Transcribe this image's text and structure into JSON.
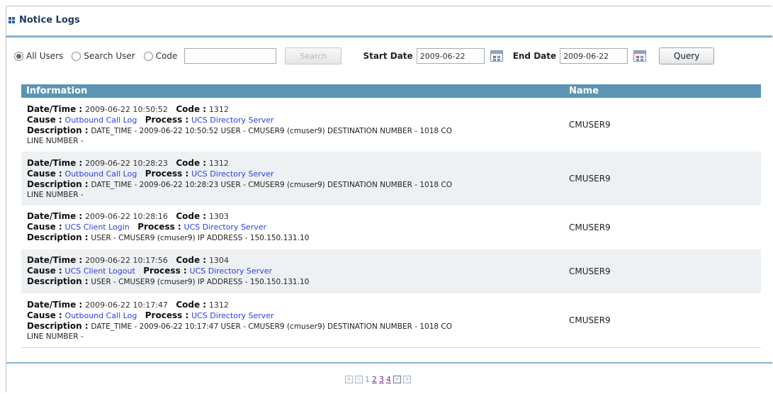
{
  "header": {
    "title": "Notice Logs"
  },
  "filters": {
    "all_users_label": "All Users",
    "search_user_label": "Search User",
    "code_label": "Code",
    "code_value": "",
    "search_button": "Search",
    "start_date_label": "Start Date",
    "start_date_value": "2009-06-22",
    "end_date_label": "End Date",
    "end_date_value": "2009-06-22",
    "query_button": "Query",
    "selected": "All Users"
  },
  "table": {
    "columns": [
      "Information",
      "Name"
    ],
    "labels": {
      "datetime": "Date/Time :",
      "code": "Code :",
      "cause": "Cause :",
      "process": "Process :",
      "description": "Description :"
    },
    "rows": [
      {
        "datetime": "2009-06-22 10:50:52",
        "code": "1312",
        "cause": "Outbound Call Log",
        "process": "UCS Directory Server",
        "description": "DATE_TIME - 2009-06-22 10:50:52 USER - CMUSER9 (cmuser9) DESTINATION NUMBER - 1018 CO",
        "description_cont": "LINE NUMBER -",
        "name": "CMUSER9"
      },
      {
        "datetime": "2009-06-22 10:28:23",
        "code": "1312",
        "cause": "Outbound Call Log",
        "process": "UCS Directory Server",
        "description": "DATE_TIME - 2009-06-22 10:28:23 USER - CMUSER9 (cmuser9) DESTINATION NUMBER - 1018 CO",
        "description_cont": "LINE NUMBER -",
        "name": "CMUSER9"
      },
      {
        "datetime": "2009-06-22 10:28:16",
        "code": "1303",
        "cause": "UCS Client Login",
        "process": "UCS Directory Server",
        "description": "USER - CMUSER9 (cmuser9) IP ADDRESS - 150.150.131.10",
        "description_cont": "",
        "name": "CMUSER9"
      },
      {
        "datetime": "2009-06-22 10:17:56",
        "code": "1304",
        "cause": "UCS Client Logout",
        "process": "UCS Directory Server",
        "description": "USER - CMUSER9 (cmuser9) IP ADDRESS - 150.150.131.10",
        "description_cont": "",
        "name": "CMUSER9"
      },
      {
        "datetime": "2009-06-22 10:17:47",
        "code": "1312",
        "cause": "Outbound Call Log",
        "process": "UCS Directory Server",
        "description": "DATE_TIME - 2009-06-22 10:17:47 USER - CMUSER9 (cmuser9) DESTINATION NUMBER - 1018 CO",
        "description_cont": "LINE NUMBER -",
        "name": "CMUSER9"
      }
    ]
  },
  "pagination": {
    "pages": [
      "1",
      "2",
      "3",
      "4"
    ],
    "current": "1",
    "first_icon": "double-chevron-left-icon",
    "prev_icon": "chevron-left-icon",
    "next_icon": "chevron-right-icon",
    "last_icon": "double-chevron-right-icon"
  },
  "colors": {
    "header_bg": "#5b95b4",
    "rule": "#86b3cd",
    "link": "#2a3ee0",
    "alt_row": "#eef1f3"
  }
}
